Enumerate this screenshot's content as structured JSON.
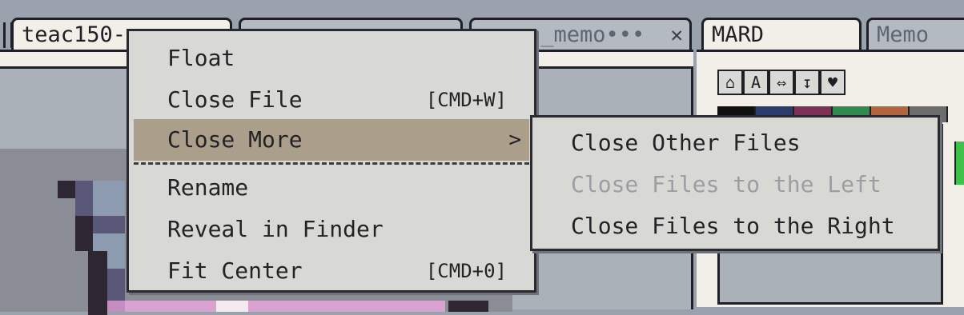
{
  "tabs": [
    {
      "label": "teac150-",
      "close": ""
    },
    {
      "label": "",
      "close": ""
    },
    {
      "label": "s_memo•••",
      "close": "✕"
    }
  ],
  "right_tabs": [
    {
      "label": "MARD"
    },
    {
      "label": "Memo"
    }
  ],
  "toolbar": {
    "icons": [
      "lock-icon",
      "text-icon",
      "resize-icon",
      "align-icon",
      "settings-icon"
    ],
    "glyphs": [
      "⌂",
      "A",
      "⇔",
      "↧",
      "♥"
    ]
  },
  "palette": {
    "colors": [
      "#101010",
      "#2a3b6e",
      "#7d2f55",
      "#2f8a4e",
      "#b4643c",
      "#6c6c6c"
    ]
  },
  "context_menu": {
    "items": [
      {
        "label": "Float",
        "shortcut": ""
      },
      {
        "label": "Close File",
        "shortcut": "[CMD+W]"
      },
      {
        "label": "Close More",
        "shortcut": "",
        "submenu_arrow": ">"
      },
      {
        "label": "Rename",
        "shortcut": ""
      },
      {
        "label": "Reveal in Finder",
        "shortcut": ""
      },
      {
        "label": "Fit Center",
        "shortcut": "[CMD+0]"
      }
    ],
    "highlight_color": "#ab9e8a"
  },
  "submenu": {
    "items": [
      {
        "label": "Close Other Files",
        "enabled": true
      },
      {
        "label": "Close Files to the Left",
        "enabled": false
      },
      {
        "label": "Close Files to the Right",
        "enabled": true
      }
    ]
  }
}
